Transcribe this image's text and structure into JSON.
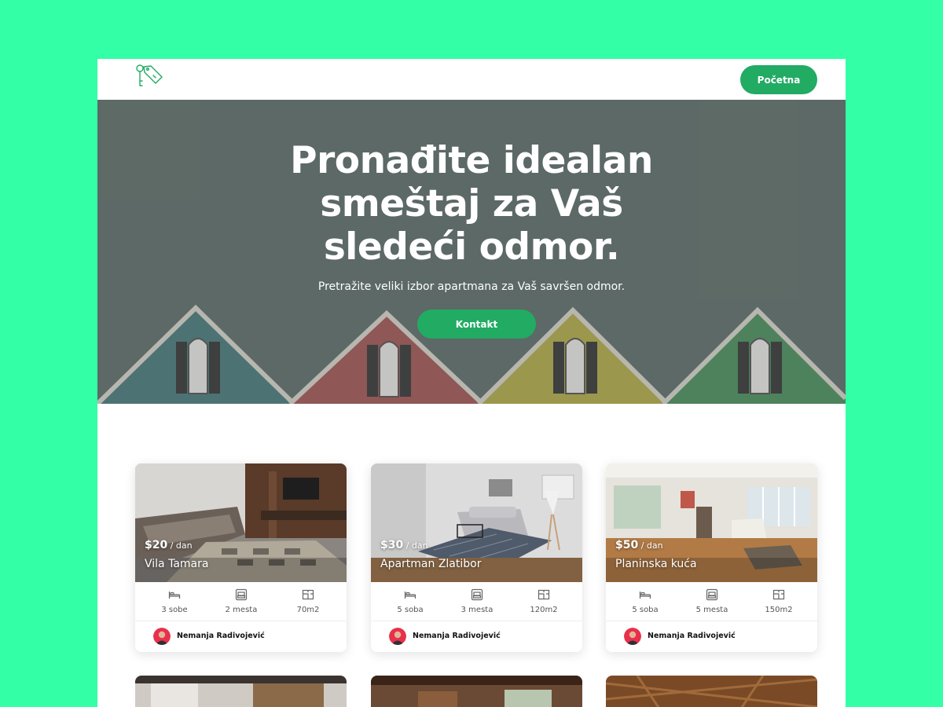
{
  "header": {
    "logo_icon": "keys-tag-icon",
    "nav_button": "Početna"
  },
  "hero": {
    "title": "Pronađite idealan smeštaj za Vaš sledeći odmor.",
    "subtitle": "Pretražite veliki izbor apartmana za Vaš savršen odmor.",
    "button": "Kontakt"
  },
  "colors": {
    "accent": "#21ab63",
    "background": "#33ffa6"
  },
  "listings": [
    {
      "price": "$20",
      "per": " / dan",
      "title": "Vila Tamara",
      "rooms": "3 sobe",
      "places": "2 mesta",
      "area": "70m2",
      "owner": "Nemanja Radivojević"
    },
    {
      "price": "$30",
      "per": " / dan",
      "title": "Apartman Zlatibor",
      "rooms": "5 soba",
      "places": "3 mesta",
      "area": "120m2",
      "owner": "Nemanja Radivojević"
    },
    {
      "price": "$50",
      "per": " / dan",
      "title": "Planinska kuća",
      "rooms": "5 soba",
      "places": "5 mesta",
      "area": "150m2",
      "owner": "Nemanja Radivojević"
    }
  ],
  "feature_icons": [
    "bed-icon",
    "sofa-icon",
    "floor-plan-icon"
  ]
}
